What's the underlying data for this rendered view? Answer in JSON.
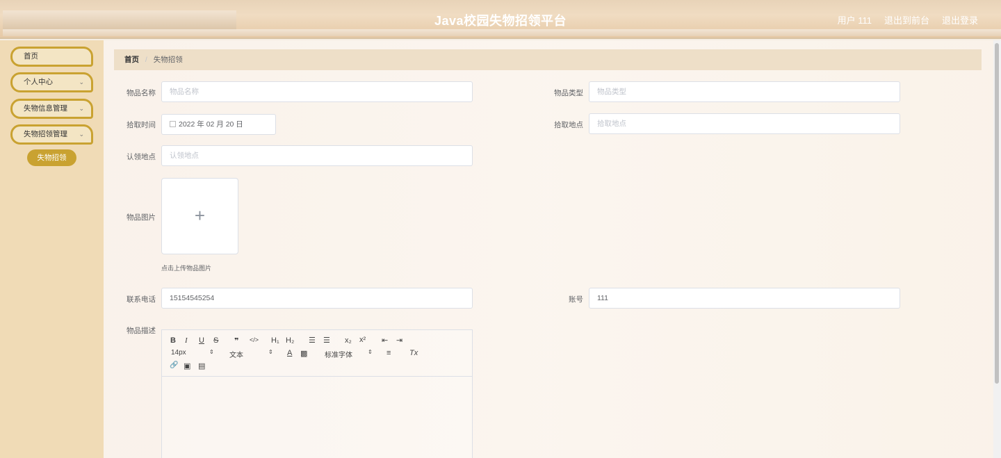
{
  "header": {
    "title": "Java校园失物招领平台",
    "user_label": "用户 111",
    "front_link": "退出到前台",
    "logout_link": "退出登录"
  },
  "sidebar": {
    "items": [
      {
        "label": "首页",
        "has_chevron": false
      },
      {
        "label": "个人中心",
        "has_chevron": true
      },
      {
        "label": "失物信息管理",
        "has_chevron": true
      },
      {
        "label": "失物招领管理",
        "has_chevron": true
      }
    ],
    "sub_item": "失物招领",
    "chevron": "⌄"
  },
  "breadcrumb": {
    "home": "首页",
    "separator": "/",
    "current": "失物招领"
  },
  "form": {
    "name": {
      "label": "物品名称",
      "placeholder": "物品名称"
    },
    "type": {
      "label": "物品类型",
      "placeholder": "物品类型"
    },
    "pick_time": {
      "label": "拾取时间",
      "value": "2022 年 02 月 20 日"
    },
    "pick_place": {
      "label": "拾取地点",
      "placeholder": "拾取地点"
    },
    "claim_place": {
      "label": "认领地点",
      "placeholder": "认领地点"
    },
    "image": {
      "label": "物品图片",
      "plus": "+",
      "tip": "点击上传物品图片"
    },
    "phone": {
      "label": "联系电话",
      "value": "15154545254"
    },
    "account": {
      "label": "账号",
      "value": "111"
    },
    "desc": {
      "label": "物品描述"
    }
  },
  "editor": {
    "bold": "B",
    "italic": "I",
    "underline": "U",
    "strike": "S",
    "quote": "❞",
    "code": "</>",
    "h1": "H₁",
    "h2": "H₂",
    "ol": "☰",
    "ul": "☰",
    "sub": "x₂",
    "sup": "x²",
    "outdent": "⇤",
    "indent": "⇥",
    "size": "14px",
    "size_arrow": "⇕",
    "style": "文本",
    "style_arrow": "⇕",
    "color": "A",
    "bg": "▩",
    "font": "标准字体",
    "font_arrow": "⇕",
    "align": "≡",
    "clean": "Tx",
    "link": "🔗",
    "image": "▣",
    "video": "▤"
  }
}
